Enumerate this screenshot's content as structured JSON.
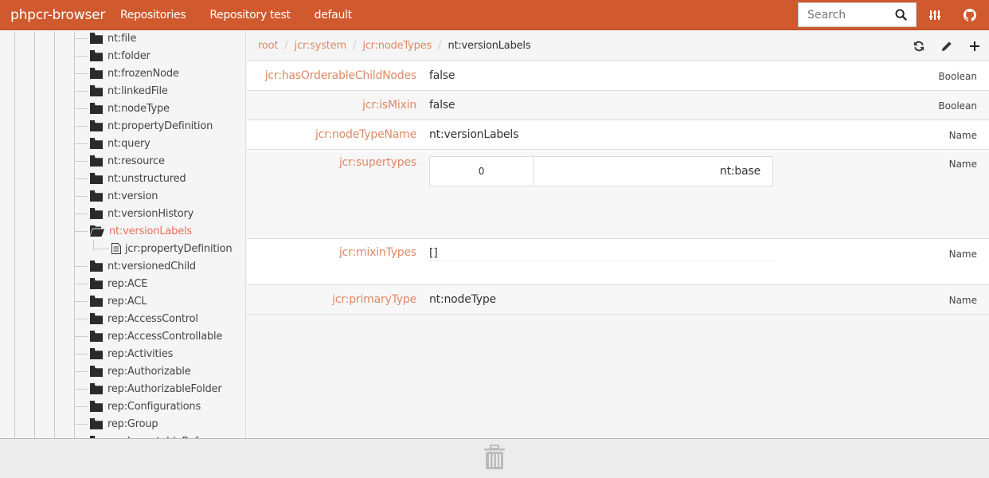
{
  "navbar": {
    "brand": "phpcr-browser",
    "links": [
      "Repositories",
      "Repository test",
      "default"
    ],
    "search_placeholder": "Search",
    "icons": [
      "search-icon",
      "settings-sliders-icon",
      "github-icon"
    ]
  },
  "tree": {
    "items": [
      {
        "label": "nt:file",
        "icon": "folder-closed"
      },
      {
        "label": "nt:folder",
        "icon": "folder-closed"
      },
      {
        "label": "nt:frozenNode",
        "icon": "folder-closed"
      },
      {
        "label": "nt:linkedFile",
        "icon": "folder-closed"
      },
      {
        "label": "nt:nodeType",
        "icon": "folder-closed"
      },
      {
        "label": "nt:propertyDefinition",
        "icon": "folder-closed"
      },
      {
        "label": "nt:query",
        "icon": "folder-closed"
      },
      {
        "label": "nt:resource",
        "icon": "folder-closed"
      },
      {
        "label": "nt:unstructured",
        "icon": "folder-closed"
      },
      {
        "label": "nt:version",
        "icon": "folder-closed"
      },
      {
        "label": "nt:versionHistory",
        "icon": "folder-closed"
      },
      {
        "label": "nt:versionLabels",
        "icon": "folder-open",
        "active": true
      },
      {
        "label": "jcr:propertyDefinition",
        "icon": "file",
        "child": true
      },
      {
        "label": "nt:versionedChild",
        "icon": "folder-closed"
      },
      {
        "label": "rep:ACE",
        "icon": "folder-closed"
      },
      {
        "label": "rep:ACL",
        "icon": "folder-closed"
      },
      {
        "label": "rep:AccessControl",
        "icon": "folder-closed"
      },
      {
        "label": "rep:AccessControllable",
        "icon": "folder-closed"
      },
      {
        "label": "rep:Activities",
        "icon": "folder-closed"
      },
      {
        "label": "rep:Authorizable",
        "icon": "folder-closed"
      },
      {
        "label": "rep:AuthorizableFolder",
        "icon": "folder-closed"
      },
      {
        "label": "rep:Configurations",
        "icon": "folder-closed"
      },
      {
        "label": "rep:Group",
        "icon": "folder-closed"
      },
      {
        "label": "rep:ImmutableReference...",
        "icon": "folder-closed",
        "partial": true
      }
    ]
  },
  "breadcrumb": {
    "items": [
      "root",
      "jcr:system",
      "jcr:nodeTypes"
    ],
    "current": "nt:versionLabels",
    "separator": "/"
  },
  "toolbar": {
    "icons": [
      "refresh-icon",
      "edit-pencil-icon",
      "add-plus-icon"
    ]
  },
  "properties": [
    {
      "name": "jcr:hasOrderableChildNodes",
      "value": "false",
      "type": "Boolean"
    },
    {
      "name": "jcr:isMixin",
      "value": "false",
      "type": "Boolean"
    },
    {
      "name": "jcr:nodeTypeName",
      "value": "nt:versionLabels",
      "type": "Name"
    },
    {
      "name": "jcr:supertypes",
      "values": [
        {
          "index": "0",
          "value": "nt:base"
        }
      ],
      "type": "Name"
    },
    {
      "name": "jcr:mixinTypes",
      "value": "[]",
      "type": "Name"
    },
    {
      "name": "jcr:primaryType",
      "value": "nt:nodeType",
      "type": "Name"
    }
  ],
  "footer": {
    "icon": "trash-icon"
  },
  "colors": {
    "brand": "#d05a2e",
    "accent_text": "#e08866",
    "active_tree": "#e8705a"
  }
}
